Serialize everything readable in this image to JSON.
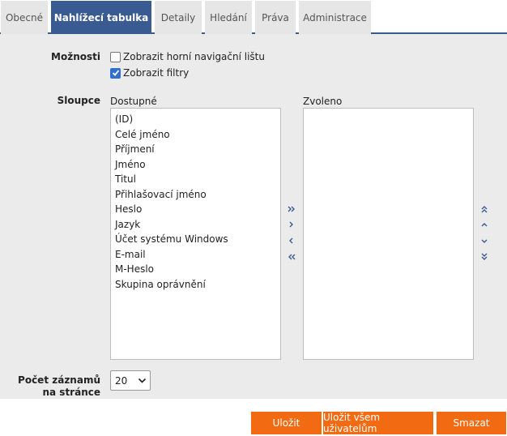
{
  "tabs": [
    {
      "label": "Obecné",
      "active": false
    },
    {
      "label": "Nahlížecí tabulka",
      "active": true
    },
    {
      "label": "Detaily",
      "active": false
    },
    {
      "label": "Hledání",
      "active": false
    },
    {
      "label": "Práva",
      "active": false
    },
    {
      "label": "Administrace",
      "active": false
    }
  ],
  "options": {
    "label": "Možnosti",
    "top_nav_label": "Zobrazit horní navigační lištu",
    "top_nav_checked": false,
    "filters_label": "Zobrazit filtry",
    "filters_checked": true
  },
  "columns": {
    "label": "Sloupce",
    "available_caption": "Dostupné",
    "selected_caption": "Zvoleno",
    "available": [
      "(ID)",
      "Celé jméno",
      "Příjmení",
      "Jméno",
      "Titul",
      "Přihlašovací jméno",
      "Heslo",
      "Jazyk",
      "Účet systému Windows",
      "E-mail",
      "M-Heslo",
      "Skupina oprávnění"
    ],
    "selected": []
  },
  "page_size": {
    "label_line1": "Počet záznamů",
    "label_line2": "na stránce",
    "value": "20"
  },
  "buttons": {
    "save": "Uložit",
    "save_all": "Uložit všem uživatelům",
    "delete": "Smazat"
  },
  "colors": {
    "accent": "#3a5a92",
    "button": "#f26b13",
    "panel": "#ebebeb"
  }
}
